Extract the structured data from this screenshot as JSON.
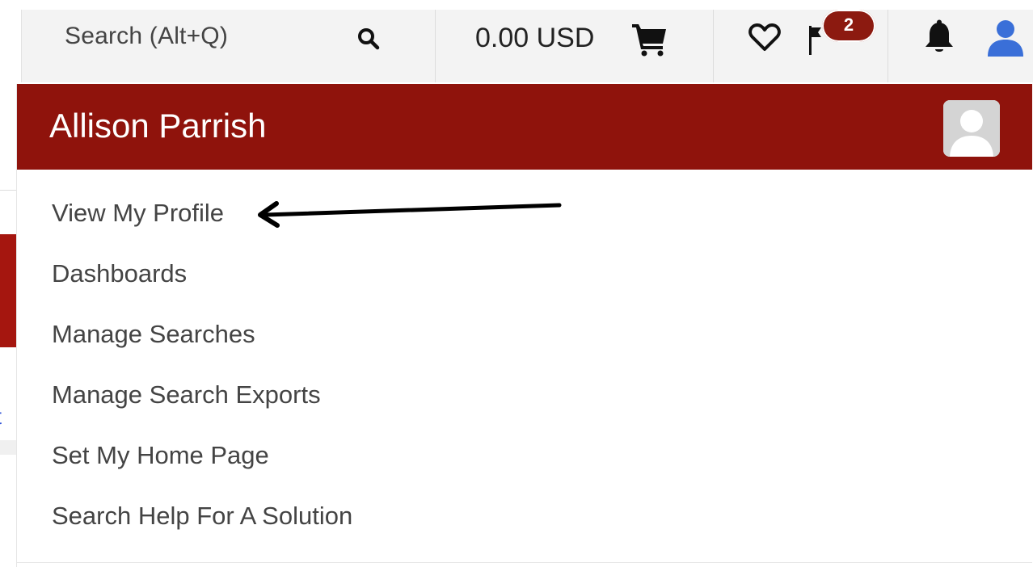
{
  "topbar": {
    "search_placeholder": "Search (Alt+Q)",
    "search_icon": "search-icon",
    "cart_total": "0.00 USD",
    "cart_icon": "cart-icon",
    "favorites_icon": "heart-icon",
    "flag_icon": "flag-icon",
    "flag_badge_count": "2",
    "notifications_icon": "bell-icon",
    "user_icon": "user-icon"
  },
  "user_menu": {
    "name": "Allison Parrish",
    "avatar_icon": "avatar-placeholder",
    "items": [
      {
        "label": "View My Profile"
      },
      {
        "label": "Dashboards"
      },
      {
        "label": "Manage Searches"
      },
      {
        "label": "Manage Search Exports"
      },
      {
        "label": "Set My Home Page"
      },
      {
        "label": "Search Help For A Solution"
      }
    ]
  },
  "annotation": {
    "icon": "arrow-left-icon",
    "points_to": "View My Profile"
  },
  "background": {
    "link_fragment": "it"
  },
  "colors": {
    "header_red": "#8f130c",
    "badge_red": "#8c1a10",
    "user_icon_blue": "#3a6fd8",
    "topbar_bg": "#f3f3f3"
  }
}
